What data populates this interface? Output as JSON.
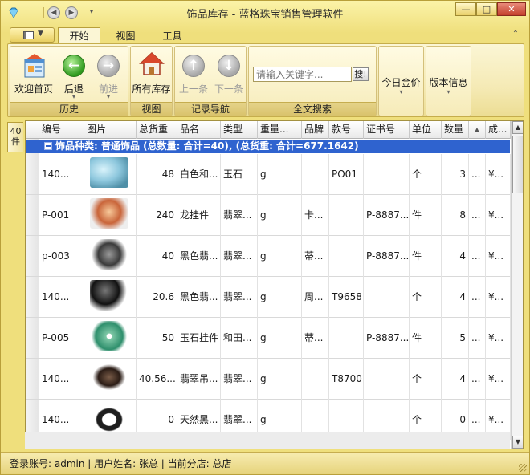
{
  "window": {
    "title": "饰品库存 - 蓝格珠宝销售管理软件",
    "buttons": {
      "min": "—",
      "max": "□",
      "close": "✕"
    }
  },
  "quick_access": {
    "back": "◀",
    "forward": "▶",
    "customize": "▾"
  },
  "tabs": [
    {
      "label": "开始",
      "active": true
    },
    {
      "label": "视图",
      "active": false
    },
    {
      "label": "工具",
      "active": false
    }
  ],
  "ribbon": {
    "groups": {
      "history": "历史",
      "view": "视图",
      "record_nav": "记录导航",
      "fulltext": "全文搜索"
    },
    "buttons": {
      "home": "欢迎首页",
      "back": "后退",
      "forward": "前进",
      "all_stock": "所有库存",
      "prev": "上一条",
      "next": "下一条",
      "gold_price": "今日金价",
      "version": "版本信息"
    },
    "search": {
      "placeholder": "请输入关键字...",
      "button": "搜!"
    }
  },
  "side_tab": "40件",
  "grid": {
    "columns": [
      "编号",
      "图片",
      "总货重",
      "品名",
      "类型",
      "重量...",
      "品牌",
      "款号",
      "证书号",
      "单位",
      "数量",
      "▲",
      "成..."
    ],
    "group_row": "饰品种类: 普通饰品 (总数量: 合计=40), (总货重: 合计=677.1642)",
    "rows": [
      {
        "id": "140...",
        "weight": "48",
        "name": "白色和...",
        "type": "玉石",
        "unit_w": "g",
        "brand": "",
        "style": "PO01",
        "cert": "",
        "unit": "个",
        "qty": "3",
        "dots": "...",
        "cost": "¥...",
        "thumb": "jade-blue"
      },
      {
        "id": "P-001",
        "weight": "240",
        "name": "龙挂件",
        "type": "翡翠...",
        "unit_w": "g",
        "brand": "卡...",
        "style": "",
        "cert": "P-8887...",
        "unit": "件",
        "qty": "8",
        "dots": "...",
        "cost": "¥...",
        "thumb": "amber"
      },
      {
        "id": "p-003",
        "weight": "40",
        "name": "黑色翡...",
        "type": "翡翠...",
        "unit_w": "g",
        "brand": "蒂...",
        "style": "",
        "cert": "P-8887...",
        "unit": "件",
        "qty": "4",
        "dots": "...",
        "cost": "¥...",
        "thumb": "black-pendant"
      },
      {
        "id": "140...",
        "weight": "20.6",
        "name": "黑色翡...",
        "type": "翡翠...",
        "unit_w": "g",
        "brand": "周...",
        "style": "T9658",
        "cert": "",
        "unit": "个",
        "qty": "4",
        "dots": "...",
        "cost": "¥...",
        "thumb": "black-bead"
      },
      {
        "id": "P-005",
        "weight": "50",
        "name": "玉石挂件",
        "type": "和田...",
        "unit_w": "g",
        "brand": "蒂...",
        "style": "",
        "cert": "P-8887...",
        "unit": "件",
        "qty": "5",
        "dots": "...",
        "cost": "¥...",
        "thumb": "jade-disc"
      },
      {
        "id": "140...",
        "weight": "40.56...",
        "name": "翡翠吊...",
        "type": "翡翠...",
        "unit_w": "g",
        "brand": "",
        "style": "T8700",
        "cert": "",
        "unit": "个",
        "qty": "4",
        "dots": "...",
        "cost": "¥...",
        "thumb": "dark-carving"
      },
      {
        "id": "140...",
        "weight": "0",
        "name": "天然黑...",
        "type": "翡翠...",
        "unit_w": "g",
        "brand": "",
        "style": "",
        "cert": "",
        "unit": "个",
        "qty": "0",
        "dots": "...",
        "cost": "¥...",
        "thumb": "bead-bracelet"
      }
    ]
  },
  "status": "登录账号: admin  |  用户姓名: 张总  |  当前分店: 总店",
  "colors": {
    "accent": "#2f63cf",
    "frame": "#efdf7c"
  }
}
